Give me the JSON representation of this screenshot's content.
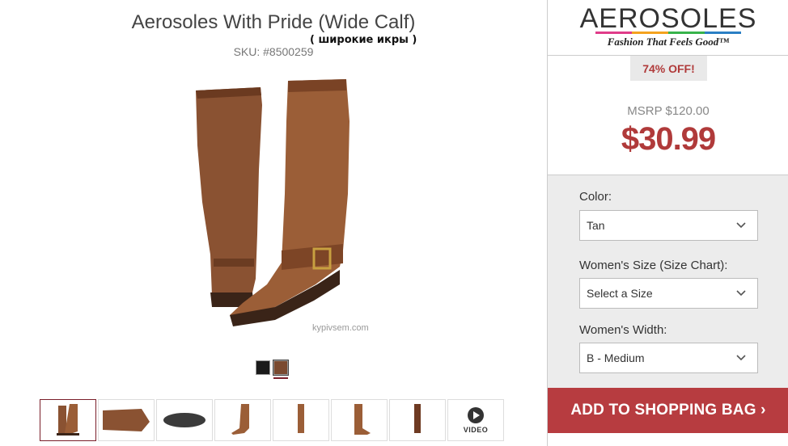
{
  "product": {
    "title": "Aerosoles With Pride (Wide Calf)",
    "annotation": "( широкие икры )",
    "sku": "SKU: #8500259",
    "watermark": "kypivsem.com"
  },
  "colors": {
    "accent": "#b73c40",
    "swatch_selected_underline": "#7a1f2a"
  },
  "swatches": [
    {
      "name": "Black"
    },
    {
      "name": "Tan"
    }
  ],
  "thumbnails": {
    "video_label": "VIDEO"
  },
  "brand": {
    "logo_text": "AEROSOLES",
    "tagline": "Fashion That Feels Good™"
  },
  "pricing": {
    "discount": "74% OFF!",
    "msrp": "MSRP $120.00",
    "price": "$30.99"
  },
  "options": {
    "color_label": "Color:",
    "color_value": "Tan",
    "size_label": "Women's Size (Size Chart):",
    "size_value": "Select a Size",
    "width_label": "Women's Width:",
    "width_value": "B - Medium"
  },
  "cta": {
    "add_to_bag": "ADD TO SHOPPING BAG ›"
  }
}
